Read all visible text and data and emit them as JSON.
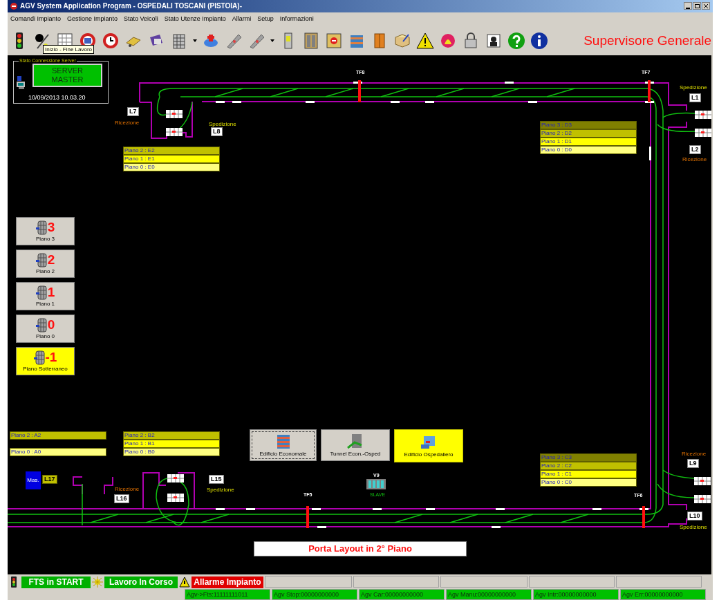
{
  "window": {
    "title": "AGV System Application Program - OSPEDALI TOSCANI (PISTOIA)-"
  },
  "menu": [
    "Comandi Impianto",
    "Gestione Impianto",
    "Stato Veicoli",
    "Stato Utenze Impianto",
    "Allarmi",
    "Setup",
    "Informazioni"
  ],
  "toolbar": {
    "tooltip": "Inizio - Fine Lavoro",
    "heading": "Supervisore Generale"
  },
  "server_panel": {
    "legend": "Stato Connessione Server",
    "status_lines": [
      "SERVER",
      "MASTER"
    ],
    "datetime": "10/09/2013 10.03.20"
  },
  "floor_buttons": [
    {
      "digit": "3",
      "label": "Piano 3",
      "selected": false
    },
    {
      "digit": "2",
      "label": "Piano 2",
      "selected": false
    },
    {
      "digit": "1",
      "label": "Piano 1",
      "selected": false
    },
    {
      "digit": "0",
      "label": "Piano 0",
      "selected": false
    },
    {
      "digit": "-1",
      "label": "Piano Sotterraneo",
      "selected": true
    }
  ],
  "floor_tables": [
    {
      "rows": [
        {
          "text": "Piano 2 : E2",
          "color": "#c0c000"
        },
        {
          "text": "Piano 1 : E1",
          "color": "#ffff00"
        },
        {
          "text": "Piano 0 : E0",
          "color": "#ffff80"
        }
      ]
    },
    {
      "rows": [
        {
          "text": "Piano 3 : D3",
          "color": "#808000"
        },
        {
          "text": "Piano 2 : D2",
          "color": "#c0c000"
        },
        {
          "text": "Piano 1 : D1",
          "color": "#ffff00"
        },
        {
          "text": "Piano 0 : D0",
          "color": "#ffff80"
        }
      ]
    },
    {
      "rows": [
        {
          "text": "Piano 2 : A2",
          "color": "#c0c000"
        },
        {
          "text": "Piano 0 : A0",
          "color": "#ffff80"
        }
      ]
    },
    {
      "rows": [
        {
          "text": "Piano 2 : B2",
          "color": "#c0c000"
        },
        {
          "text": "Piano 1 : B1",
          "color": "#ffff00"
        },
        {
          "text": "Piano 0 : B0",
          "color": "#ffff80"
        }
      ]
    },
    {
      "rows": [
        {
          "text": "Piano 3 : C3",
          "color": "#808000"
        },
        {
          "text": "Piano 2 : C2",
          "color": "#c0c000"
        },
        {
          "text": "Piano 1 : C1",
          "color": "#ffff00"
        },
        {
          "text": "Piano 0 : C0",
          "color": "#ffff80"
        }
      ]
    }
  ],
  "stations": [
    {
      "label": "L7",
      "role": "Ricezione",
      "kind": "reception"
    },
    {
      "label": "L8",
      "role": "Spedizione",
      "kind": "shipping"
    },
    {
      "label": "L1",
      "role": "Spedizione",
      "kind": "shipping"
    },
    {
      "label": "L2",
      "role": "Ricezione",
      "kind": "reception"
    },
    {
      "label": "L9",
      "role": "Ricezione",
      "kind": "reception"
    },
    {
      "label": "L10",
      "role": "Spedizione",
      "kind": "shipping"
    },
    {
      "label": "L15",
      "role": "Spedizione",
      "kind": "shipping"
    },
    {
      "label": "L16",
      "role": "Ricezione",
      "kind": "reception"
    }
  ],
  "lift": {
    "label": "L17",
    "tag": "Mas."
  },
  "gates": [
    "TF8",
    "TF7",
    "TF5",
    "TF6"
  ],
  "vehicle": {
    "label": "V9",
    "mode": "SLAVE"
  },
  "buildings": [
    {
      "label": "Edificio Economale",
      "selected": false,
      "focused": true
    },
    {
      "label": "Tunnel Econ.-Osped",
      "selected": false,
      "focused": false
    },
    {
      "label": "Edificio Ospedaliero",
      "selected": true,
      "focused": false
    }
  ],
  "layout_button": "Porta Layout in 2° Piano",
  "status_bar": {
    "indicators": [
      {
        "kind": "start",
        "text": "FTS in START"
      },
      {
        "kind": "work",
        "text": "Lavoro In Corso"
      },
      {
        "kind": "alarm",
        "text": "Allarme Impianto"
      }
    ],
    "counters": [
      "Agv->Fts:11111111011",
      "Agv Stop:00000000000",
      "Agv Car:00000000000",
      "Agv Manu:00000000000",
      "Agv Intr:00000000000",
      "Agv Err:00000000000"
    ]
  }
}
